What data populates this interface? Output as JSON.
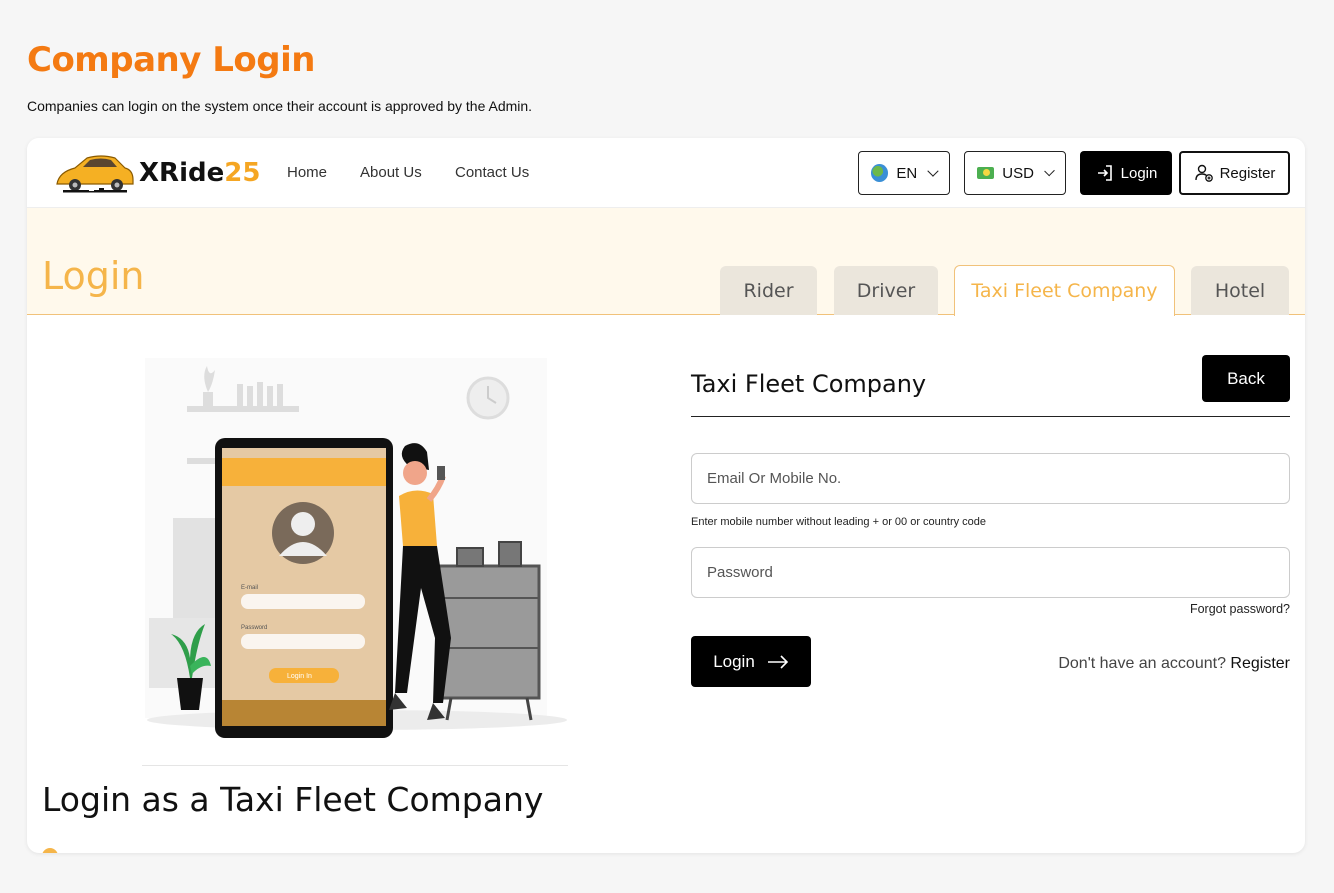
{
  "page": {
    "title": "Company Login",
    "subtitle": "Companies can login on the system once their account is approved by the Admin."
  },
  "header": {
    "brand_name": "XRide",
    "brand_num": "25",
    "nav": [
      {
        "label": "Home"
      },
      {
        "label": "About Us"
      },
      {
        "label": "Contact Us"
      }
    ],
    "language": "EN",
    "currency": "USD",
    "login_label": "Login",
    "register_label": "Register"
  },
  "banner": {
    "title": "Login",
    "tabs": [
      {
        "label": "Rider",
        "active": false
      },
      {
        "label": "Driver",
        "active": false
      },
      {
        "label": "Taxi Fleet Company",
        "active": true
      },
      {
        "label": "Hotel",
        "active": false
      }
    ]
  },
  "illustration": {
    "email_label": "E-mail",
    "password_label": "Password",
    "button_label": "Login In"
  },
  "left": {
    "heading": "Login as a Taxi Fleet Company"
  },
  "form": {
    "title": "Taxi Fleet Company",
    "back_label": "Back",
    "email_placeholder": "Email Or Mobile No.",
    "email_hint": "Enter mobile number without leading + or 00 or country code",
    "password_placeholder": "Password",
    "forgot_label": "Forgot password?",
    "login_label": "Login",
    "no_account_text": "Don't have an account?",
    "register_link": "Register"
  },
  "colors": {
    "accent_orange": "#f47a12",
    "accent_yellow": "#f5b54a",
    "banner_bg": "#fff9ec"
  }
}
